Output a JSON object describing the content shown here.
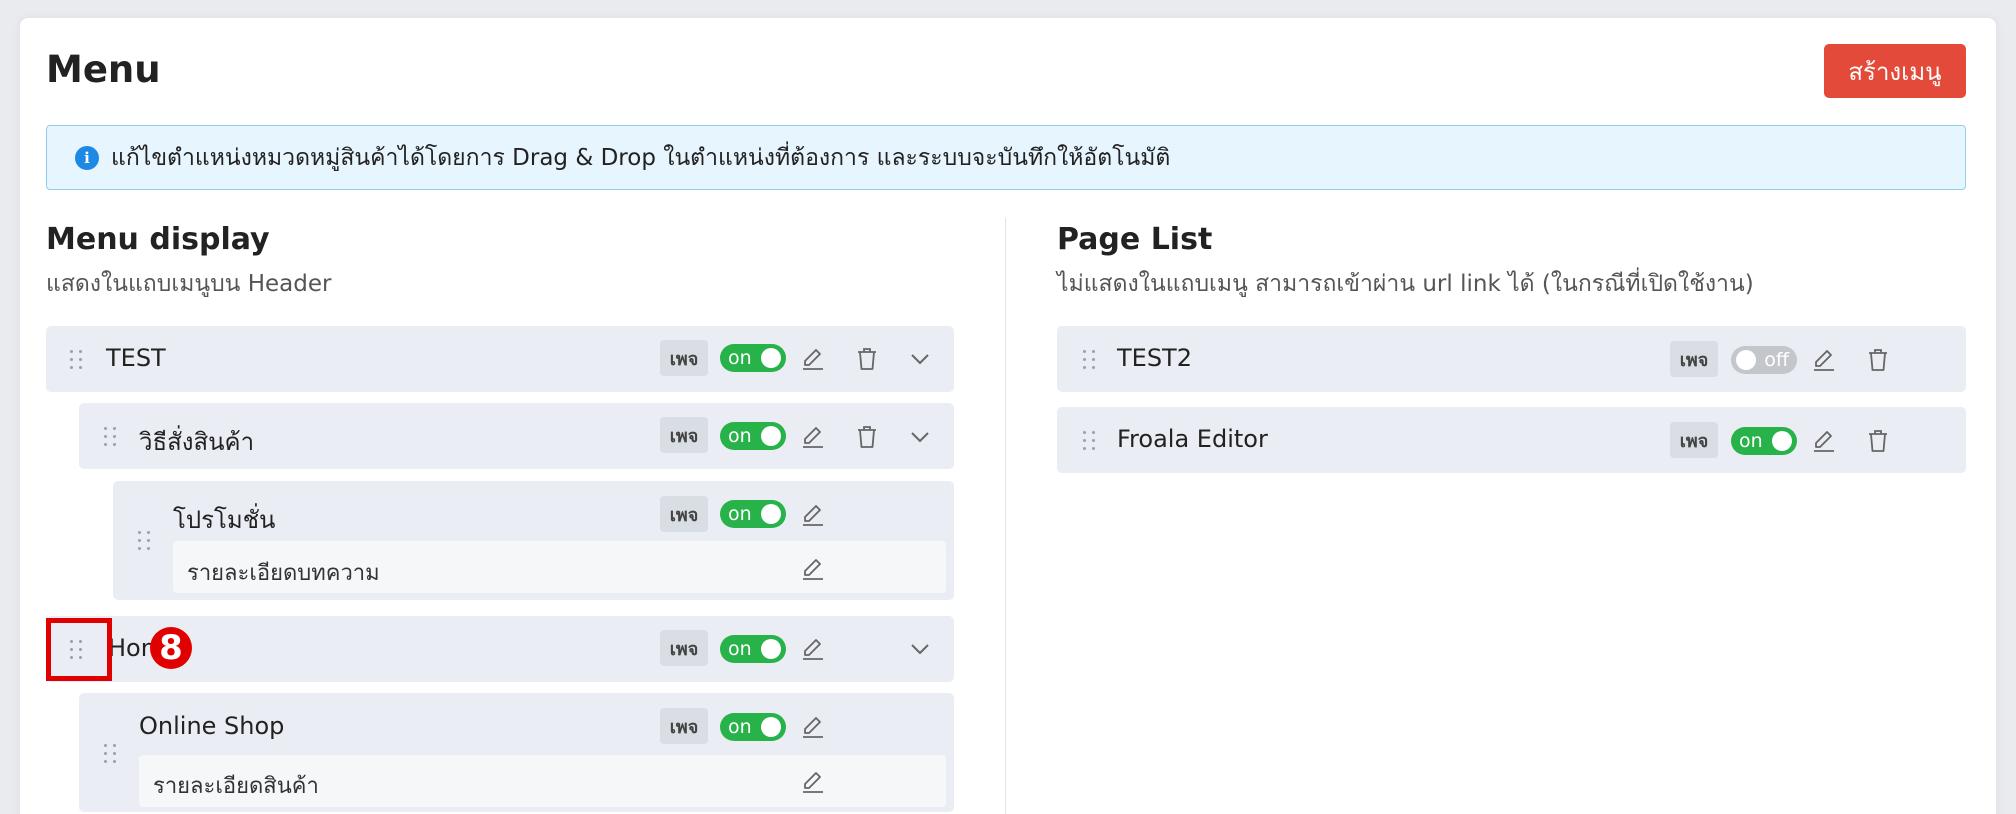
{
  "header": {
    "title": "Menu",
    "create_button": "สร้างเมนู"
  },
  "info": {
    "icon": "info-icon",
    "glyph": "i",
    "text": "แก้ไขตำแหน่งหมวดหมู่สินค้าได้โดยการ Drag & Drop ในตำแหน่งที่ต้องการ และระบบจะบันทึกให้อัตโนมัติ"
  },
  "menu_display": {
    "title": "Menu display",
    "subtitle": "แสดงในแถบเมนูบน Header",
    "items": [
      {
        "label": "TEST",
        "badge": "เพจ",
        "toggle": "on"
      },
      {
        "label": "วิธีสั่งสินค้า",
        "badge": "เพจ",
        "toggle": "on"
      },
      {
        "label": "โปรโมชั่น",
        "badge": "เพจ",
        "toggle": "on",
        "sub_label": "รายละเอียดบทความ"
      },
      {
        "label": "Hon",
        "badge": "เพจ",
        "toggle": "on"
      },
      {
        "label": "Online Shop",
        "badge": "เพจ",
        "toggle": "on",
        "sub_label": "รายละเอียดสินค้า"
      }
    ]
  },
  "page_list": {
    "title": "Page List",
    "subtitle": "ไม่แสดงในแถบเมนู สามารถเข้าผ่าน url link ได้ (ในกรณีที่เปิดใช้งาน)",
    "items": [
      {
        "label": "TEST2",
        "badge": "เพจ",
        "toggle": "off"
      },
      {
        "label": "Froala Editor",
        "badge": "เพจ",
        "toggle": "on"
      }
    ]
  },
  "annotation": {
    "marker": "8"
  },
  "colors": {
    "accent": "#e34a3a",
    "toggle_on": "#27b24a",
    "toggle_off": "#c3c6cb",
    "highlight": "#e00000",
    "info_bg": "#e7f5fe"
  }
}
